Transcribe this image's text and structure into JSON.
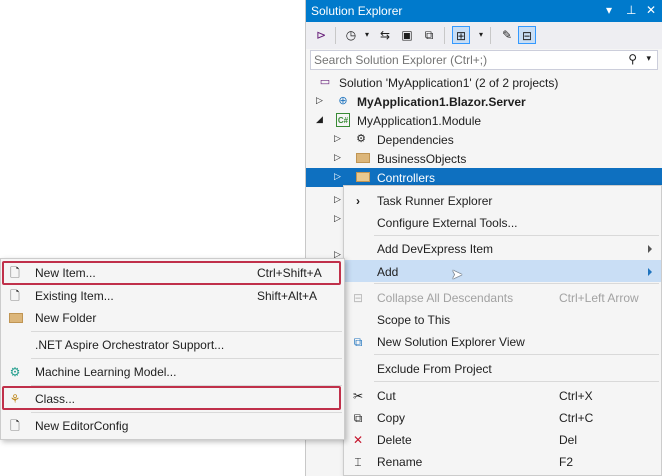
{
  "panel": {
    "title": "Solution Explorer",
    "controls": [
      "▾",
      "⊿",
      "✕"
    ],
    "search_placeholder": "Search Solution Explorer (Ctrl+;)"
  },
  "tree": [
    {
      "label": "Solution 'MyApplication1' (2 of 2 projects)",
      "icon": "solution-icon",
      "bold": false
    },
    {
      "label": "MyApplication1.Blazor.Server",
      "icon": "web-project-icon",
      "bold": true
    },
    {
      "label": "MyApplication1.Module",
      "icon": "csharp-project-icon",
      "bold": false
    },
    {
      "label": "Dependencies",
      "icon": "dependencies-icon",
      "bold": false
    },
    {
      "label": "BusinessObjects",
      "icon": "folder-icon",
      "bold": false
    },
    {
      "label": "Controllers",
      "icon": "folder-icon",
      "bold": false
    }
  ],
  "context_menu": {
    "items": [
      {
        "label": "Task Runner Explorer",
        "shortcut": "",
        "icon": "chevron-right-icon"
      },
      {
        "label": "Configure External Tools...",
        "shortcut": "",
        "icon": ""
      },
      {
        "label": "Add DevExpress Item",
        "shortcut": "",
        "icon": ""
      },
      {
        "label": "Add",
        "shortcut": "",
        "icon": ""
      },
      {
        "label": "Collapse All Descendants",
        "shortcut": "Ctrl+Left Arrow",
        "icon": "collapse-icon"
      },
      {
        "label": "Scope to This",
        "shortcut": "",
        "icon": ""
      },
      {
        "label": "New Solution Explorer View",
        "shortcut": "",
        "icon": "new-view-icon"
      },
      {
        "label": "Exclude From Project",
        "shortcut": "",
        "icon": ""
      },
      {
        "label": "Cut",
        "shortcut": "Ctrl+X",
        "icon": "scissors-icon"
      },
      {
        "label": "Copy",
        "shortcut": "Ctrl+C",
        "icon": "copy-icon"
      },
      {
        "label": "Delete",
        "shortcut": "Del",
        "icon": "delete-icon"
      },
      {
        "label": "Rename",
        "shortcut": "F2",
        "icon": "rename-icon"
      }
    ]
  },
  "add_submenu": {
    "items": [
      {
        "label": "New Item...",
        "shortcut": "Ctrl+Shift+A"
      },
      {
        "label": "Existing Item...",
        "shortcut": "Shift+Alt+A"
      },
      {
        "label": "New Folder",
        "shortcut": ""
      },
      {
        "label": ".NET Aspire Orchestrator Support...",
        "shortcut": ""
      },
      {
        "label": "Machine Learning Model...",
        "shortcut": ""
      },
      {
        "label": "Class...",
        "shortcut": ""
      },
      {
        "label": "New EditorConfig",
        "shortcut": ""
      }
    ]
  },
  "colors": {
    "accent": "#007acc",
    "selection": "#0e70c0",
    "highlight": "#c9def5",
    "callout": "#c0304a"
  }
}
